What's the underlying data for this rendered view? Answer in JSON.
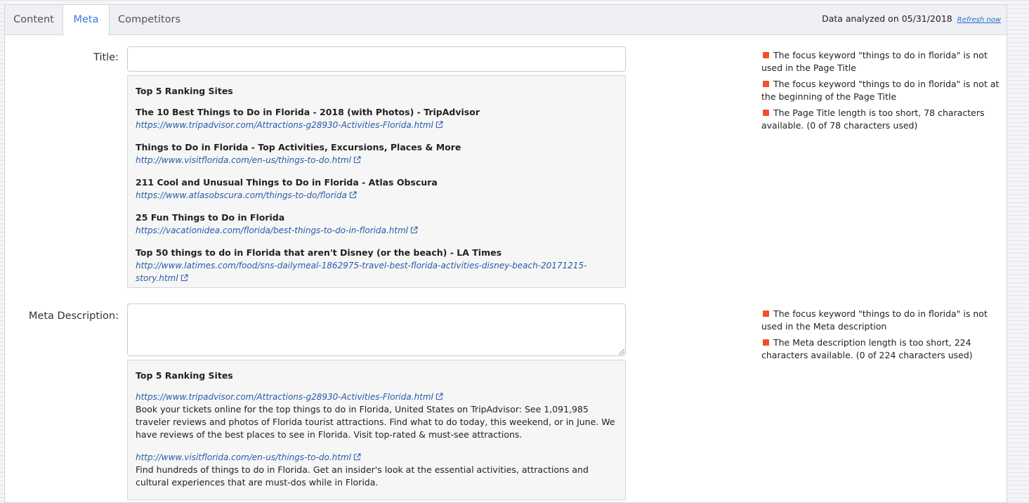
{
  "tabs": [
    {
      "label": "Content"
    },
    {
      "label": "Meta"
    },
    {
      "label": "Competitors"
    }
  ],
  "analyzed": {
    "text": "Data analyzed on 05/31/2018",
    "refresh_label": "Refresh now"
  },
  "title_section": {
    "label": "Title:",
    "value": "",
    "heading": "Top 5 Ranking Sites",
    "sites": [
      {
        "title": "The 10 Best Things to Do in Florida - 2018 (with Photos) - TripAdvisor",
        "url": "https://www.tripadvisor.com/Attractions-g28930-Activities-Florida.html"
      },
      {
        "title": "Things to Do in Florida - Top Activities, Excursions, Places & More",
        "url": "http://www.visitflorida.com/en-us/things-to-do.html"
      },
      {
        "title": "211 Cool and Unusual Things to Do in Florida - Atlas Obscura",
        "url": "https://www.atlasobscura.com/things-to-do/florida"
      },
      {
        "title": "25 Fun Things to Do in Florida",
        "url": "https://vacationidea.com/florida/best-things-to-do-in-florida.html"
      },
      {
        "title": "Top 50 things to do in Florida that aren't Disney (or the beach) - LA Times",
        "url": "http://www.latimes.com/food/sns-dailymeal-1862975-travel-best-florida-activities-disney-beach-20171215-story.html"
      }
    ],
    "issues": [
      "The focus keyword \"things to do in florida\" is not used in the Page Title",
      "The focus keyword \"things to do in florida\" is not at the beginning of the Page Title",
      "The Page Title length is too short, 78 characters available. (0 of 78 characters used)"
    ]
  },
  "meta_section": {
    "label": "Meta Description:",
    "value": "",
    "heading": "Top 5 Ranking Sites",
    "sites": [
      {
        "url": "https://www.tripadvisor.com/Attractions-g28930-Activities-Florida.html",
        "desc": "Book your tickets online for the top things to do in Florida, United States on TripAdvisor: See 1,091,985 traveler reviews and photos of Florida tourist attractions. Find what to do today, this weekend, or in June. We have reviews of the best places to see in Florida. Visit top-rated & must-see attractions."
      },
      {
        "url": "http://www.visitflorida.com/en-us/things-to-do.html",
        "desc": "Find hundreds of things to do in Florida. Get an insider's look at the essential activities, attractions and cultural experiences that are must-dos while in Florida."
      }
    ],
    "issues": [
      "The focus keyword \"things to do in florida\" is not used in the Meta description",
      "The Meta description length is too short, 224 characters available. (0 of 224 characters used)"
    ]
  },
  "colors": {
    "issue": "#f0502b",
    "link": "#2a5aa8",
    "active_tab": "#3b7ad9"
  }
}
